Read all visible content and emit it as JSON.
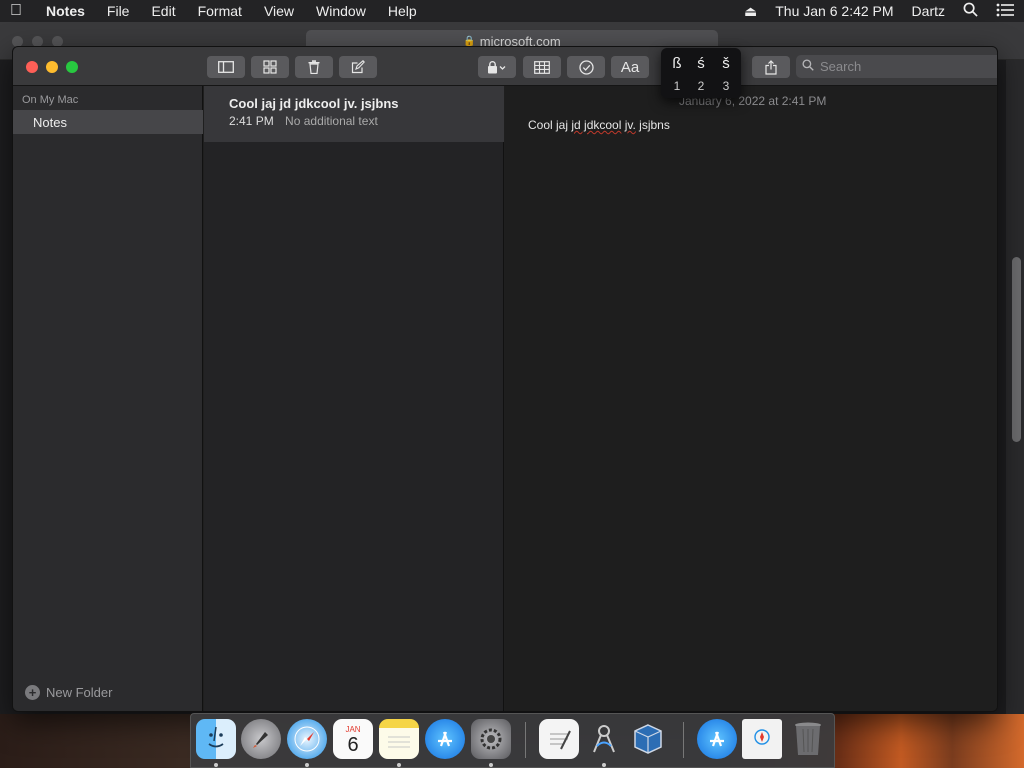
{
  "menubar": {
    "apple": "",
    "app": "Notes",
    "items": [
      "File",
      "Edit",
      "Format",
      "View",
      "Window",
      "Help"
    ],
    "datetime": "Thu Jan 6  2:42 PM",
    "user": "Dartz"
  },
  "safari": {
    "url": "microsoft.com"
  },
  "sidebar": {
    "header": "On My Mac",
    "folder": "Notes",
    "new_folder": "New Folder"
  },
  "search": {
    "placeholder": "Search"
  },
  "note_list": {
    "items": [
      {
        "title": "Cool jaj jd jdkcool jv. jsjbns",
        "time": "2:41 PM",
        "preview": "No additional text"
      }
    ]
  },
  "editor": {
    "date": "January 6, 2022 at 2:41 PM",
    "body_parts": [
      "Cool jaj ",
      "jd jdkcool",
      " ",
      "jv.",
      " jsjbns"
    ]
  },
  "accent_popover": {
    "chars": [
      "ß",
      "ś",
      "š"
    ],
    "numbers": [
      "1",
      "2",
      "3"
    ]
  },
  "toolbar": {
    "format_label": "Aa"
  },
  "dock": {
    "calendar_month": "JAN",
    "calendar_day": "6"
  },
  "colors": {
    "close": "#fe5f57",
    "minimize": "#febc2e",
    "zoom": "#28c840"
  }
}
